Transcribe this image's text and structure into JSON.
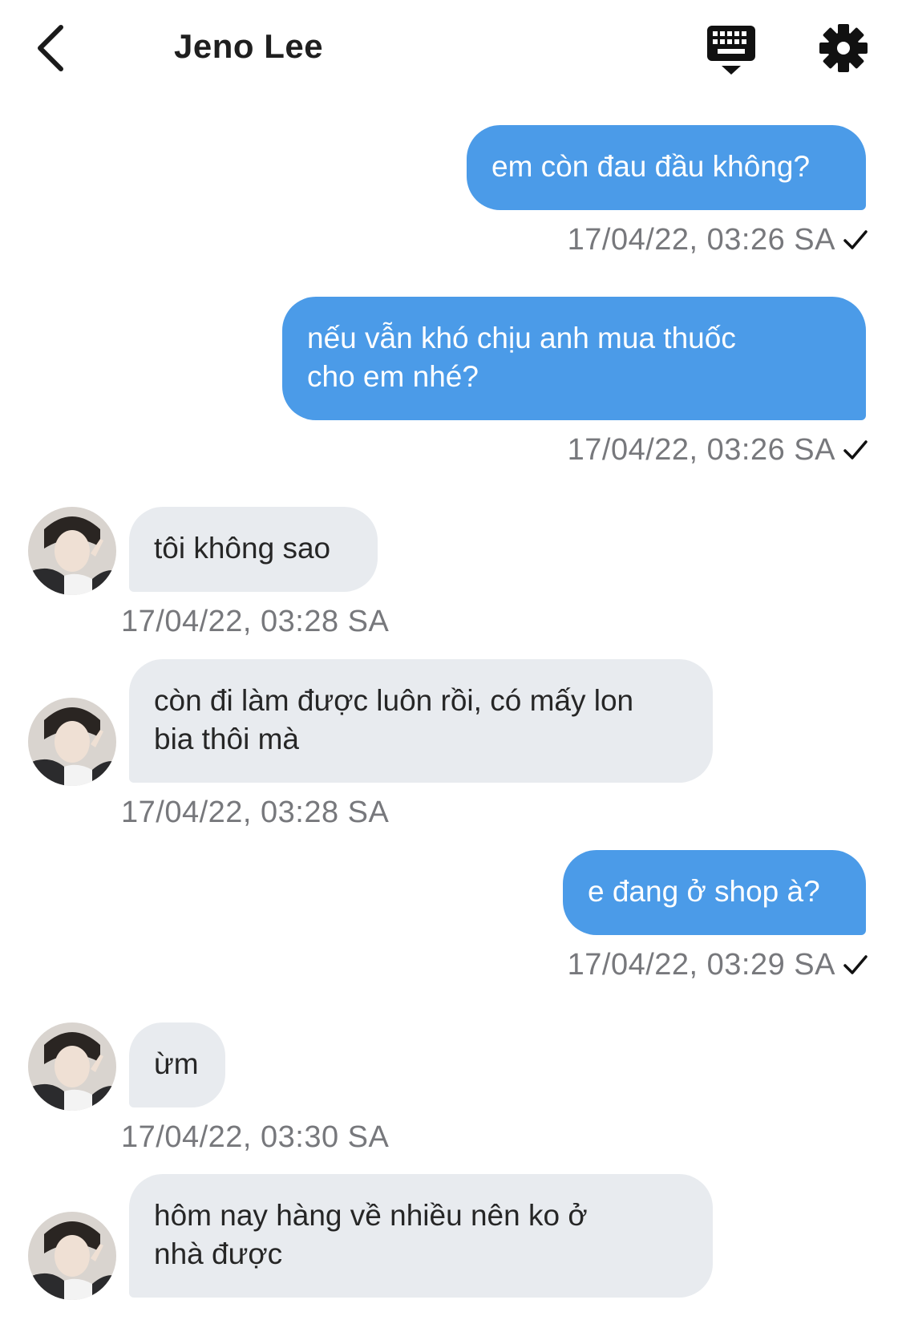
{
  "header": {
    "title": "Jeno Lee",
    "back_icon": "chevron-left-icon",
    "keyboard_icon": "keyboard-icon",
    "settings_icon": "gear-icon"
  },
  "colors": {
    "outgoing_bubble": "#4b9be8",
    "incoming_bubble": "#e8ebef",
    "timestamp": "#77787c"
  },
  "messages": [
    {
      "direction": "outgoing",
      "text": "em còn đau đầu không?",
      "time": "17/04/22, 03:26 SA",
      "read": true
    },
    {
      "direction": "outgoing",
      "text": "nếu vẫn khó chịu anh mua thuốc\ncho em nhé?",
      "time": "17/04/22, 03:26 SA",
      "read": true
    },
    {
      "direction": "incoming",
      "text": "tôi không sao",
      "time": "17/04/22, 03:28 SA"
    },
    {
      "direction": "incoming",
      "text": "còn đi làm được luôn rồi, có mấy lon\nbia thôi mà",
      "time": "17/04/22, 03:28 SA"
    },
    {
      "direction": "outgoing",
      "text": "e đang ở shop à?",
      "time": "17/04/22, 03:29 SA",
      "read": true
    },
    {
      "direction": "incoming",
      "text": "ừm",
      "time": "17/04/22, 03:30 SA"
    },
    {
      "direction": "incoming",
      "text": "hôm nay hàng về nhiều nên ko ở\nnhà được",
      "time": ""
    }
  ]
}
